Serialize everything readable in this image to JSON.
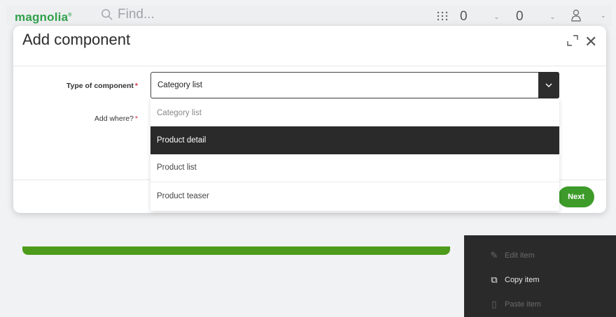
{
  "app": {
    "logo": "magnolia",
    "search_placeholder": "Find...",
    "selector_1": "0",
    "selector_2": "0"
  },
  "dialog": {
    "title": "Add component",
    "fields": {
      "type_label": "Type of component",
      "type_value": "Category list",
      "where_label": "Add where?",
      "required_mark": "*"
    },
    "dropdown_options": [
      "Category list",
      "Product detail",
      "Product list",
      "Product teaser"
    ],
    "highlighted_option_index": 1,
    "next_label": "Next"
  },
  "context_menu": {
    "items": [
      {
        "label": "Edit item",
        "icon": "edit-icon"
      },
      {
        "label": "Copy item",
        "icon": "copy-icon"
      },
      {
        "label": "Paste item",
        "icon": "paste-icon"
      }
    ]
  },
  "colors": {
    "brand_green": "#2fa14b",
    "button_green": "#3d9b2a",
    "required_red": "#d0303f",
    "highlight_dark": "#2a2a2a"
  }
}
